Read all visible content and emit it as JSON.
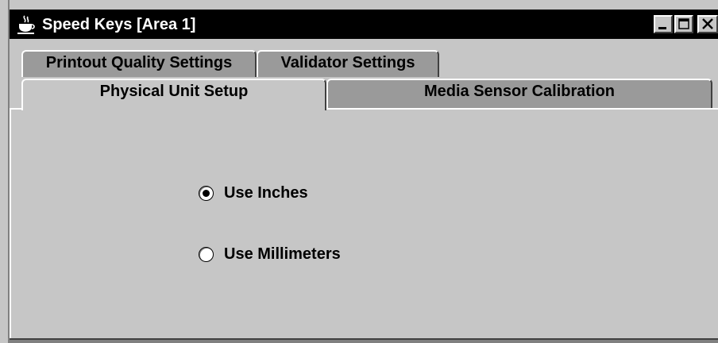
{
  "window": {
    "title": "Speed Keys [Area 1]",
    "app_icon": "java-coffee-cup-icon"
  },
  "titlebar_buttons": {
    "minimize_icon": "minimize-icon",
    "maximize_icon": "maximize-icon",
    "close_icon": "close-icon"
  },
  "tabs": {
    "row1": [
      {
        "label": "Printout Quality Settings"
      },
      {
        "label": "Validator Settings"
      }
    ],
    "row2": [
      {
        "label": "Physical Unit Setup",
        "selected": true
      },
      {
        "label": "Media Sensor Calibration",
        "selected": false
      }
    ]
  },
  "units": {
    "options": [
      {
        "label": "Use Inches",
        "checked": true
      },
      {
        "label": "Use Millimeters",
        "checked": false
      }
    ]
  },
  "colors": {
    "titlebar": "#000000",
    "panel": "#c6c6c6",
    "inactive_tab": "#9a9a9a"
  }
}
